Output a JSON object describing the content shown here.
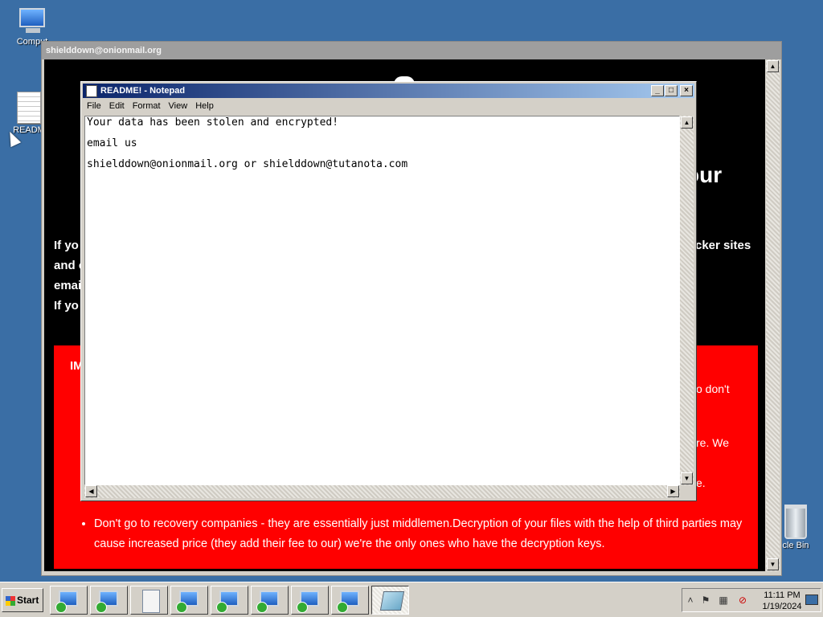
{
  "desktop": {
    "icons": [
      {
        "label": "Comput",
        "icon": "computer-icon"
      },
      {
        "label": "READM",
        "icon": "text-document-icon"
      },
      {
        "label": "cle Bin",
        "icon": "recycle-bin-icon"
      }
    ]
  },
  "background_window": {
    "title": "shielddown@onionmail.org",
    "heading_fragment": "our",
    "lines": [
      {
        "left": "If yo",
        "right": "cker sites"
      },
      {
        "left": "and c",
        "right": ""
      },
      {
        "left": "emai",
        "right": ""
      },
      {
        "left": "If yo",
        "right": ""
      }
    ],
    "red_box": {
      "heading_fragment": "IM",
      "fragments": [
        "o don't",
        "re. We",
        "e."
      ],
      "bullet": "Don't go to recovery companies - they are essentially just middlemen.Decryption of your files with the help of third parties may cause increased price (they add their fee to our) we're the only ones who have the decryption keys."
    },
    "colors": {
      "background": "#000000",
      "alert": "#ff0000"
    }
  },
  "notepad": {
    "title": "README! - Notepad",
    "menu": [
      "File",
      "Edit",
      "Format",
      "View",
      "Help"
    ],
    "lines": [
      "Your data has been stolen and encrypted!",
      "email us",
      "shielddown@onionmail.org or shielddown@tutanota.com"
    ]
  },
  "taskbar": {
    "start_label": "Start",
    "buttons": [
      "setup-icon",
      "setup-icon",
      "document-icon",
      "setup-icon",
      "setup-icon",
      "setup-icon",
      "setup-icon",
      "setup-icon",
      "notepad-icon"
    ],
    "active_button": "notepad-icon",
    "clock": {
      "time": "11:11 PM",
      "date": "1/19/2024"
    }
  }
}
